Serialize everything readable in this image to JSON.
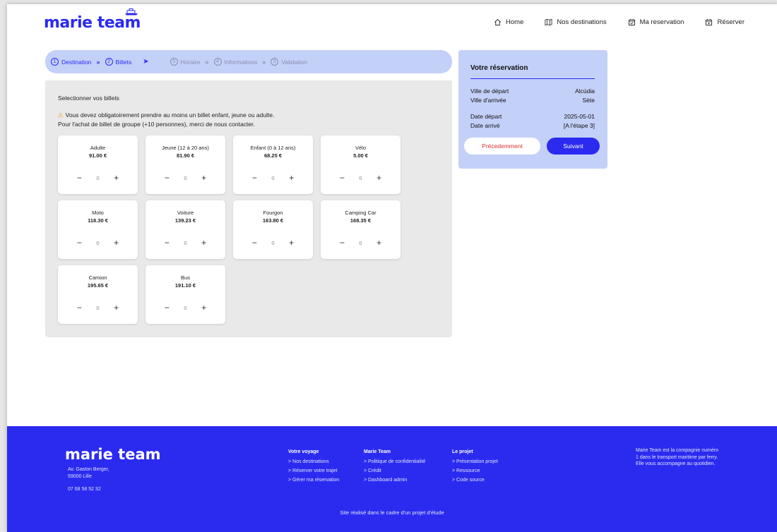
{
  "header": {
    "logo": "marie team",
    "nav": [
      {
        "label": "Home",
        "icon": "home-icon"
      },
      {
        "label": "Nos destinations",
        "icon": "map-icon"
      },
      {
        "label": "Ma reservation",
        "icon": "calendar-check-icon"
      },
      {
        "label": "Réserver",
        "icon": "calendar-plus-icon"
      }
    ]
  },
  "stepper": {
    "steps": [
      {
        "num": "1",
        "label": "Destination",
        "state": "done"
      },
      {
        "num": "2",
        "label": "Billets",
        "state": "current"
      },
      {
        "num": "3",
        "label": "Horaire",
        "state": "todo"
      },
      {
        "num": "4",
        "label": "Informations",
        "state": "todo"
      },
      {
        "num": "5",
        "label": "Validation",
        "state": "todo"
      }
    ],
    "separator": "»"
  },
  "tickets": {
    "title": "Selectionner vos billets",
    "warning": "Vous devez obligatoirement prendre au moins un billet enfant, jeune ou adulte.",
    "group_note": "Pour l'achat de billet de groupe (+10 personnes), merci de nous contacter.",
    "items": [
      {
        "name": "Adulte",
        "price": "91.00 €",
        "qty": "0"
      },
      {
        "name": "Jeune (12 à 20 ans)",
        "price": "81.90 €",
        "qty": "0"
      },
      {
        "name": "Enfant (0 à 12 ans)",
        "price": "68.25 €",
        "qty": "0"
      },
      {
        "name": "Vélo",
        "price": "5.00 €",
        "qty": "0"
      },
      {
        "name": "Moto",
        "price": "118.30 €",
        "qty": "0"
      },
      {
        "name": "Voiture",
        "price": "139.23 €",
        "qty": "0"
      },
      {
        "name": "Fourgon",
        "price": "163.80 €",
        "qty": "0"
      },
      {
        "name": "Camping Car",
        "price": "168.35 €",
        "qty": "0"
      },
      {
        "name": "Camion",
        "price": "195.65 €",
        "qty": "0"
      },
      {
        "name": "Bus",
        "price": "191.10 €",
        "qty": "0"
      }
    ],
    "minus": "−",
    "plus": "+"
  },
  "reservation": {
    "title": "Votre réservation",
    "depart_city_label": "Ville de départ",
    "depart_city": "Alcúdia",
    "arrival_city_label": "Ville d'arrivée",
    "arrival_city": "Sète",
    "depart_date_label": "Date départ",
    "depart_date": "2025-05-01",
    "arrival_date_label": "Date arrivé",
    "arrival_date": "[A l'étape 3]",
    "prev_label": "Précedemment",
    "next_label": "Suivant"
  },
  "footer": {
    "logo": "marie team",
    "address_line1": "Av. Gaston Berger,",
    "address_line2": "59000 Lille",
    "phone": "07 68 58 52 32",
    "columns": [
      {
        "title": "Votre voyage",
        "links": [
          "> Nos destinations",
          "> Réserver votre trajet",
          "> Gérer ma réservation"
        ]
      },
      {
        "title": "Marie Team",
        "links": [
          "> Politique de confidentialité",
          "> Crédit",
          "> Dashboard admin"
        ]
      },
      {
        "title": "Le projet",
        "links": [
          "> Présentation projet",
          "> Ressource",
          "> Code source"
        ]
      }
    ],
    "description": "Marie Team est la compagnie numéro 1 dans le transport maritime par ferry. Elle vous accompagne au quotidien.",
    "credit": "Site réalisé dans le cadre d'un projet d'étude"
  },
  "colors": {
    "accent": "#2b2bf0",
    "light_accent": "#c3d0f8",
    "danger": "#e03030",
    "panel": "#e9e9e9"
  }
}
